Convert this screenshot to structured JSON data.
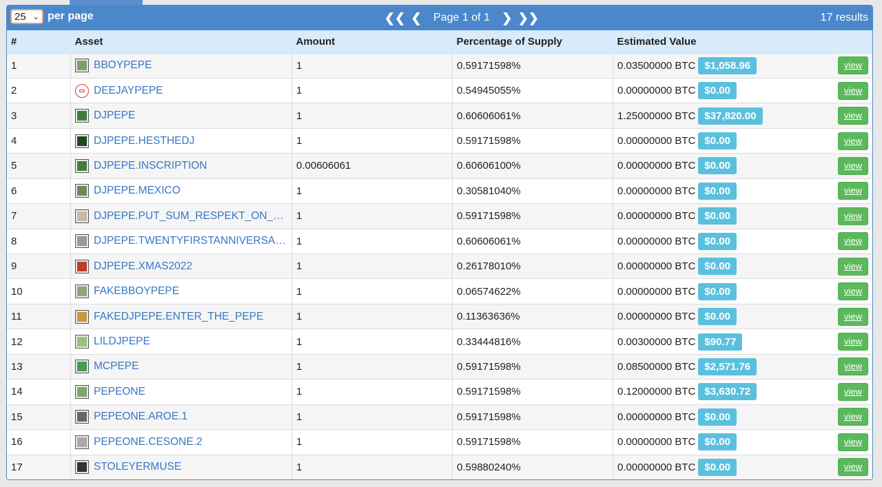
{
  "pager": {
    "per_page_value": "25",
    "per_page_label": "per page",
    "page_label": "Page 1 of 1",
    "results": "17 results"
  },
  "headers": {
    "num": "#",
    "asset": "Asset",
    "amount": "Amount",
    "pct": "Percentage of Supply",
    "value": "Estimated Value"
  },
  "view_label": "view",
  "rows": [
    {
      "n": "1",
      "asset": "BBOYPEPE",
      "amount": "1",
      "pct": "0.59171598%",
      "btc": "0.03500000 BTC",
      "usd": "$1,058.96",
      "thumb": "#7aa06a"
    },
    {
      "n": "2",
      "asset": "DEEJAYPEPE",
      "amount": "1",
      "pct": "0.54945055%",
      "btc": "0.00000000 BTC",
      "usd": "$0.00",
      "thumb": "circle"
    },
    {
      "n": "3",
      "asset": "DJPEPE",
      "amount": "1",
      "pct": "0.60606061%",
      "btc": "1.25000000 BTC",
      "usd": "$37,820.00",
      "thumb": "#3f7d3f"
    },
    {
      "n": "4",
      "asset": "DJPEPE.HESTHEDJ",
      "amount": "1",
      "pct": "0.59171598%",
      "btc": "0.00000000 BTC",
      "usd": "$0.00",
      "thumb": "#1f4a1f"
    },
    {
      "n": "5",
      "asset": "DJPEPE.INSCRIPTION",
      "amount": "0.00606061",
      "pct": "0.60606100%",
      "btc": "0.00000000 BTC",
      "usd": "$0.00",
      "thumb": "#3f7d3f"
    },
    {
      "n": "6",
      "asset": "DJPEPE.MEXICO",
      "amount": "1",
      "pct": "0.30581040%",
      "btc": "0.00000000 BTC",
      "usd": "$0.00",
      "thumb": "#6a8a5a"
    },
    {
      "n": "7",
      "asset": "DJPEPE.PUT_SUM_RESPEKT_ON_M…",
      "amount": "1",
      "pct": "0.59171598%",
      "btc": "0.00000000 BTC",
      "usd": "$0.00",
      "thumb": "#c8b8a8"
    },
    {
      "n": "8",
      "asset": "DJPEPE.TWENTYFIRSTANNIVERSARY",
      "amount": "1",
      "pct": "0.60606061%",
      "btc": "0.00000000 BTC",
      "usd": "$0.00",
      "thumb": "#999999"
    },
    {
      "n": "9",
      "asset": "DJPEPE.XMAS2022",
      "amount": "1",
      "pct": "0.26178010%",
      "btc": "0.00000000 BTC",
      "usd": "$0.00",
      "thumb": "#c0392b"
    },
    {
      "n": "10",
      "asset": "FAKEBBOYPEPE",
      "amount": "1",
      "pct": "0.06574622%",
      "btc": "0.00000000 BTC",
      "usd": "$0.00",
      "thumb": "#8aa87a"
    },
    {
      "n": "11",
      "asset": "FAKEDJPEPE.ENTER_THE_PEPE",
      "amount": "1",
      "pct": "0.11363636%",
      "btc": "0.00000000 BTC",
      "usd": "$0.00",
      "thumb": "#c89a3a"
    },
    {
      "n": "12",
      "asset": "LILDJPEPE",
      "amount": "1",
      "pct": "0.33444816%",
      "btc": "0.00300000 BTC",
      "usd": "$90.77",
      "thumb": "#9ac07a"
    },
    {
      "n": "13",
      "asset": "MCPEPE",
      "amount": "1",
      "pct": "0.59171598%",
      "btc": "0.08500000 BTC",
      "usd": "$2,571.76",
      "thumb": "#4a9a4a"
    },
    {
      "n": "14",
      "asset": "PEPEONE",
      "amount": "1",
      "pct": "0.59171598%",
      "btc": "0.12000000 BTC",
      "usd": "$3,630.72",
      "thumb": "#7aaa6a"
    },
    {
      "n": "15",
      "asset": "PEPEONE.AROE.1",
      "amount": "1",
      "pct": "0.59171598%",
      "btc": "0.00000000 BTC",
      "usd": "$0.00",
      "thumb": "#666666"
    },
    {
      "n": "16",
      "asset": "PEPEONE.CESONE.2",
      "amount": "1",
      "pct": "0.59171598%",
      "btc": "0.00000000 BTC",
      "usd": "$0.00",
      "thumb": "#aaaaaa"
    },
    {
      "n": "17",
      "asset": "STOLEYERMUSE",
      "amount": "1",
      "pct": "0.59880240%",
      "btc": "0.00000000 BTC",
      "usd": "$0.00",
      "thumb": "#333333"
    }
  ]
}
